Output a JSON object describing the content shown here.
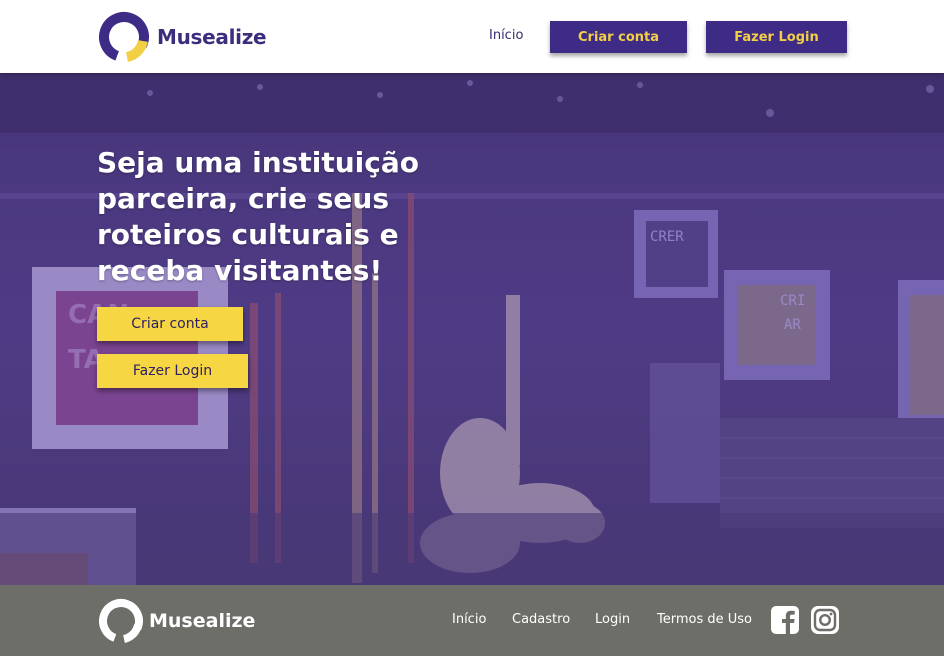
{
  "brand": {
    "name": "Musealize",
    "primary_color": "#3d2b86",
    "accent_color": "#f6d743"
  },
  "header": {
    "nav_home": "Início",
    "create_account_label": "Criar conta",
    "login_label": "Fazer Login"
  },
  "hero": {
    "headline": "Seja uma instituição parceira, crie seus roteiros culturais e receba visitantes!",
    "create_account_label": "Criar conta",
    "login_label": "Fazer Login",
    "background_image": "museum interior photo with purple overlay"
  },
  "footer": {
    "brand": "Musealize",
    "links": [
      "Início",
      "Cadastro",
      "Login",
      "Termos de Uso"
    ],
    "social_icons": [
      "facebook-icon",
      "instagram-icon"
    ]
  }
}
